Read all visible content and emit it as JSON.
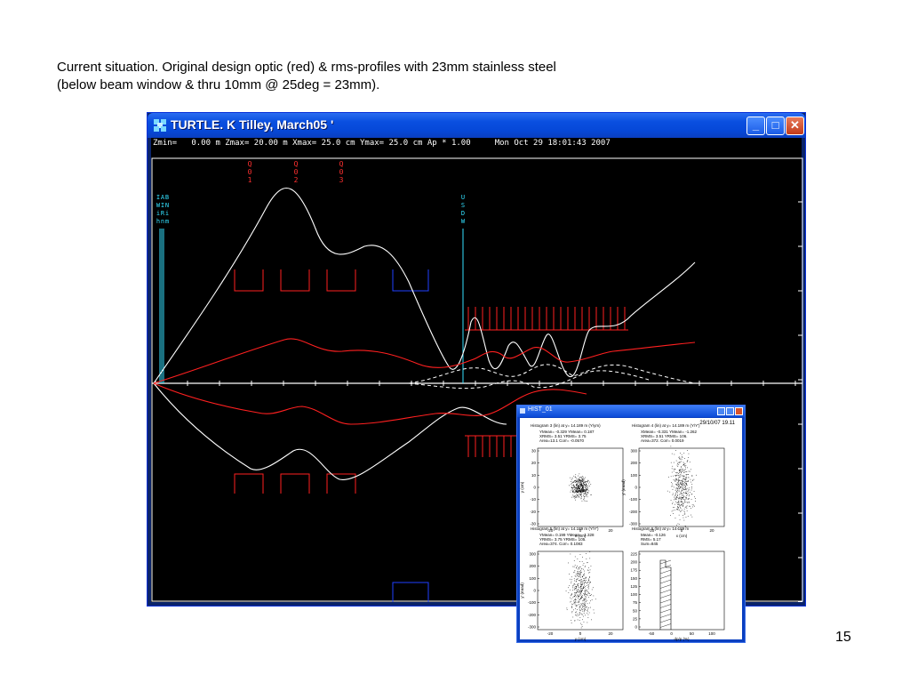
{
  "caption": {
    "line1": "Current situation. Original design optic (red) & rms-profiles with 23mm stainless steel",
    "line2": "(below beam window & thru 10mm @ 25deg = 23mm)."
  },
  "main_window": {
    "title": "TURTLE. K Tilley, March05 '",
    "status": "Zmin=   0.00 m Zmax= 20.00 m Xmax= 25.0 cm Ymax= 25.0 cm Ap * 1.00     Mon Oct 29 18:01:43 2007",
    "buttons": {
      "minimize": "_",
      "maximize": "□",
      "close": "✕"
    },
    "magnet_labels": [
      {
        "text": [
          "Q",
          "0",
          "1"
        ],
        "color": "#ff3030"
      },
      {
        "text": [
          "Q",
          "0",
          "2"
        ],
        "color": "#ff3030"
      },
      {
        "text": [
          "Q",
          "0",
          "3"
        ],
        "color": "#ff3030"
      }
    ],
    "window_labels": [
      {
        "text": [
          "I",
          "W",
          "i",
          "h"
        ],
        "color": "#33e0ff"
      },
      {
        "text": [
          "A",
          "I",
          "R",
          "n"
        ],
        "color": "#33e0ff"
      },
      {
        "text": [
          "B",
          "N",
          "i",
          "m"
        ],
        "color": "#33e0ff"
      }
    ],
    "usdw_label": {
      "text": [
        "U",
        "S",
        "D",
        "W"
      ],
      "color": "#33e0ff"
    },
    "colors": {
      "beam_white": "#ffffff",
      "optic_red": "#ff2020",
      "element_blue": "#2040ff",
      "marker_cyan": "#33e0ff"
    }
  },
  "hist_window": {
    "title": "HIST_01",
    "date": "29/10/07   19.11",
    "panels": [
      {
        "header": "Histogram   3 (lin) at y= 14.189 m (Y/ym)",
        "stats": [
          "YMean= -0.329  YMean= 0.187",
          "XRMS= 3.51    YRMS= 3.75",
          "Area=13.1     Corr= -0.0570"
        ],
        "xlabel": "x (cm)",
        "ylabel": "y (cm)",
        "xticks": [
          "-20",
          "0",
          "20"
        ],
        "yticks": [
          "30",
          "20",
          "10",
          "0",
          "-10",
          "-20",
          "-30"
        ]
      },
      {
        "header": "Histogram   4 (lin) at y= 14.189 m (Y/Y')",
        "stats": [
          "XMean= -0.331  YMean= -1.262",
          "XRMS= 3.51    YRMS= 106.",
          "Area=372.     Corr= 0.0019"
        ],
        "xlabel": "x (cm)",
        "ylabel": "y' (mrad)",
        "xticks": [
          "-20",
          "0",
          "20"
        ],
        "yticks": [
          "300",
          "200",
          "100",
          "0",
          "-100",
          "-200",
          "-300"
        ]
      },
      {
        "header": "Histogram   5 (lin) at y= 14.189 m (Y/Y')",
        "stats": [
          "YMean= 0.199  YMean= -1.328",
          "YRMS= 3.75   YRMS= 105.",
          "Area=374.     Corr= 0.1083"
        ],
        "xlabel": "y (cm)",
        "ylabel": "y' (mrad)",
        "xticks": [
          "-20",
          "0",
          "20"
        ],
        "yticks": [
          "300",
          "200",
          "100",
          "0",
          "-100",
          "-200",
          "-300"
        ]
      },
      {
        "header": "Histogram   6 (lin) at y= 14.189 m",
        "stats": [
          "Mean= -0.126",
          "RMS= 5.17",
          "Sum=845"
        ],
        "xlabel": "dp/p (%)",
        "ylabel": "",
        "xticks": [
          "-50",
          "0",
          "50",
          "100"
        ],
        "yticks": [
          "225",
          "200",
          "175",
          "150",
          "125",
          "100",
          "75",
          "50",
          "25",
          "0"
        ]
      }
    ]
  },
  "slide_number": "15"
}
